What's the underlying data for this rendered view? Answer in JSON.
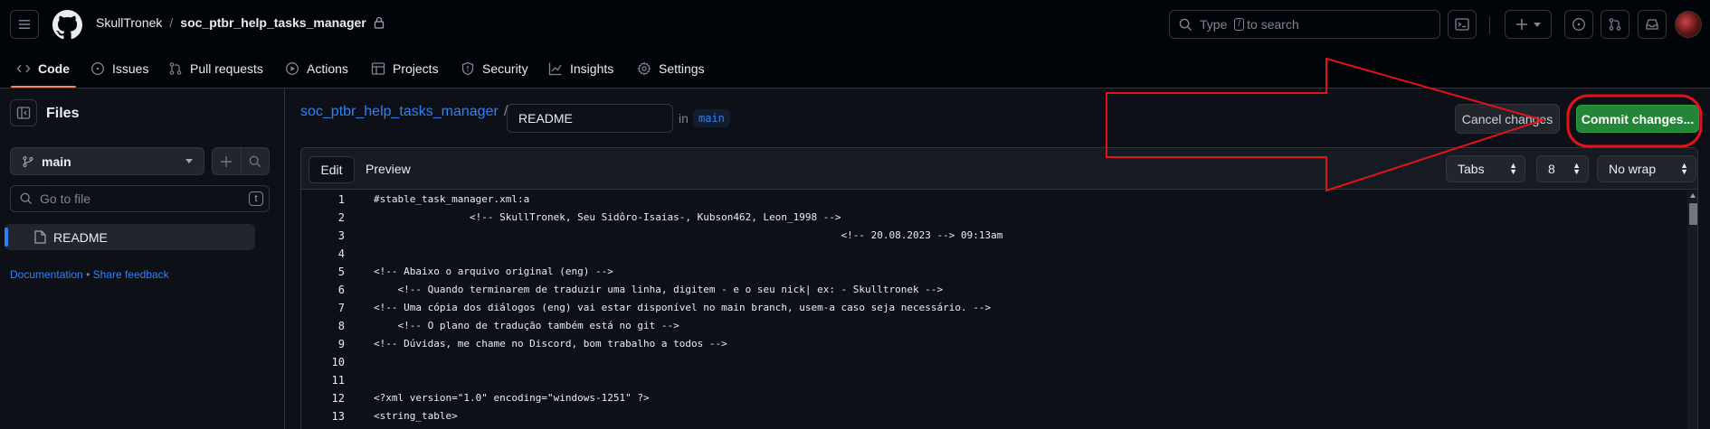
{
  "header": {
    "owner": "SkullTronek",
    "separator": "/",
    "repo": "soc_ptbr_help_tasks_manager",
    "search_prefix": "Type",
    "search_key": "/",
    "search_suffix": "to search"
  },
  "tabs": [
    {
      "label": "Code",
      "icon": "code-icon"
    },
    {
      "label": "Issues",
      "icon": "issue-icon"
    },
    {
      "label": "Pull requests",
      "icon": "pull-request-icon"
    },
    {
      "label": "Actions",
      "icon": "play-icon"
    },
    {
      "label": "Projects",
      "icon": "table-icon"
    },
    {
      "label": "Security",
      "icon": "shield-icon"
    },
    {
      "label": "Insights",
      "icon": "graph-icon"
    },
    {
      "label": "Settings",
      "icon": "gear-icon"
    }
  ],
  "sidebar": {
    "title": "Files",
    "branch": "main",
    "goto_placeholder": "Go to file",
    "goto_key": "t",
    "file": "README",
    "links": {
      "documentation": "Documentation",
      "dot": "•",
      "feedback": "Share feedback"
    }
  },
  "editor_header": {
    "repo_link": "soc_ptbr_help_tasks_manager",
    "slash": "/",
    "filename": "README",
    "in_label": "in",
    "branch": "main",
    "cancel_label": "Cancel changes",
    "commit_label": "Commit changes..."
  },
  "editor_toolbar": {
    "edit_label": "Edit",
    "preview_label": "Preview",
    "indent_mode": "Tabs",
    "indent_size": "8",
    "wrap_mode": "No wrap"
  },
  "code": {
    "line_numbers": [
      "1",
      "2",
      "3",
      "4",
      "5",
      "6",
      "7",
      "8",
      "9",
      "10",
      "11",
      "12",
      "13"
    ],
    "lines": [
      "#stable_task_manager.xml:a",
      "                <!-- SkullTronek, Seu Sidôro-Isaias-, Kubson462, Leon_1998 -->",
      "                                                                              <!-- 20.08.2023 --> 09:13am",
      "",
      "<!-- Abaixo o arquivo original (eng) -->",
      "    <!-- Quando terminarem de traduzir uma linha, digitem - e o seu nick| ex: - Skulltronek -->",
      "<!-- Uma cópia dos diálogos (eng) vai estar disponível no main branch, usem-a caso seja necessário. -->",
      "    <!-- O plano de tradução também está no git -->",
      "<!-- Dúvidas, me chame no Discord, bom trabalho a todos -->",
      "",
      "",
      "<?xml version=\"1.0\" encoding=\"windows-1251\" ?>",
      "<string_table>"
    ]
  },
  "colors": {
    "accent": "#2f81f7",
    "commit_green": "#238636",
    "annotation_red": "#e3121b",
    "tab_underline": "#f78166"
  }
}
